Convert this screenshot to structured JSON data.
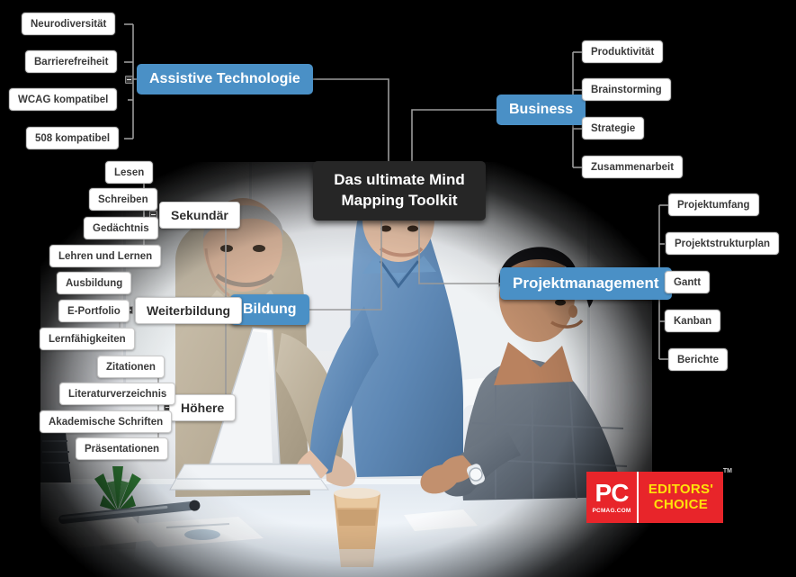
{
  "root": {
    "line1": "Das ultimate Mind",
    "line2": "Mapping Toolkit"
  },
  "colors": {
    "branch_blue": "#4a90c6",
    "root_dark": "#262626",
    "leaf_white": "#ffffff",
    "badge_red": "#e8252a",
    "badge_yellow": "#ffe20a",
    "canvas_black": "#000000",
    "wire_gray": "#9a9a9a"
  },
  "branches": [
    {
      "id": "assistive-technologie",
      "label": "Assistive Technologie",
      "children": [
        {
          "label": "Neurodiversität"
        },
        {
          "label": "Barrierefreiheit"
        },
        {
          "label": "WCAG kompatibel"
        },
        {
          "label": "508 kompatibel"
        }
      ]
    },
    {
      "id": "business",
      "label": "Business",
      "children": [
        {
          "label": "Produktivität"
        },
        {
          "label": "Brainstorming"
        },
        {
          "label": "Strategie"
        },
        {
          "label": "Zusammenarbeit"
        }
      ]
    },
    {
      "id": "projektmanagement",
      "label": "Projektmanagement",
      "children": [
        {
          "label": "Projektumfang"
        },
        {
          "label": "Projektstrukturplan"
        },
        {
          "label": "Gantt"
        },
        {
          "label": "Kanban"
        },
        {
          "label": "Berichte"
        }
      ]
    },
    {
      "id": "bildung",
      "label": "Bildung",
      "groups": [
        {
          "label": "Sekundär",
          "children": [
            {
              "label": "Lesen"
            },
            {
              "label": "Schreiben"
            },
            {
              "label": "Gedächtnis"
            },
            {
              "label": "Lehren und Lernen"
            }
          ]
        },
        {
          "label": "Weiterbildung",
          "children": [
            {
              "label": "Ausbildung"
            },
            {
              "label": "E-Portfolio"
            },
            {
              "label": "Lernfähigkeiten"
            }
          ]
        },
        {
          "label": "Höhere",
          "children": [
            {
              "label": "Zitationen"
            },
            {
              "label": "Literaturverzeichnis"
            },
            {
              "label": "Akademische Schriften"
            },
            {
              "label": "Präsentationen"
            }
          ]
        }
      ]
    }
  ],
  "badge": {
    "brand": "PC",
    "url": "PCMAG.COM",
    "line1": "EDITORS'",
    "line2": "CHOICE",
    "tm": "TM"
  }
}
